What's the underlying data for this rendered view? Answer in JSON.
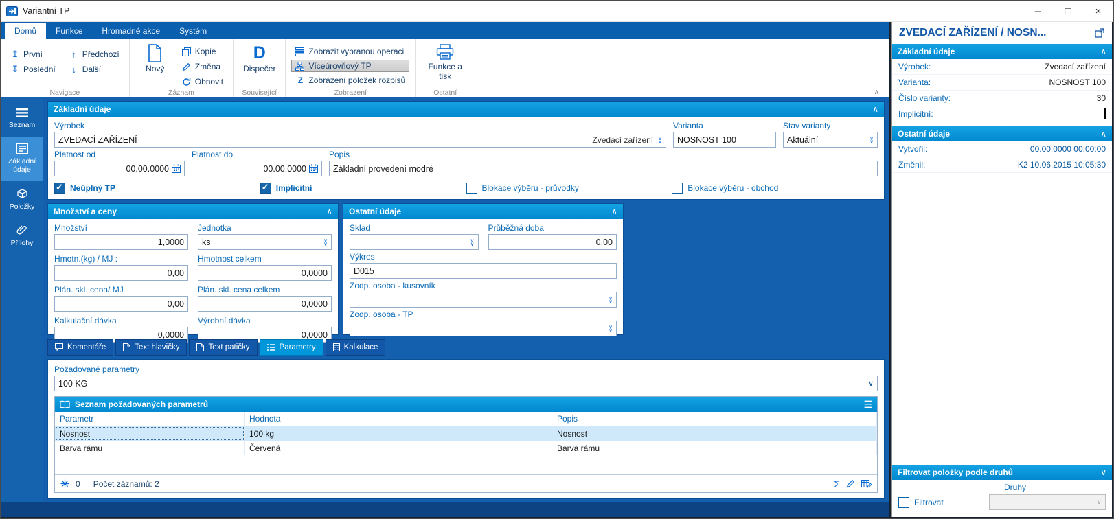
{
  "window": {
    "title": "Variantní TP"
  },
  "icons": {
    "minimize": "–",
    "maximize": "□",
    "close": "×",
    "first": "↥",
    "last": "↧",
    "previous": "↑",
    "next": "↓",
    "chevron_up": "∧",
    "chevron_down": "∨",
    "hamburger": "☰",
    "sigma": "Σ",
    "dispatcher_letter": "D",
    "z_letter": "Z"
  },
  "ribbon": {
    "tabs": [
      {
        "label": "Domů"
      },
      {
        "label": "Funkce"
      },
      {
        "label": "Hromadné akce"
      },
      {
        "label": "Systém"
      }
    ],
    "nav": {
      "first": "První",
      "last": "Poslední",
      "previous": "Předchozí",
      "next": "Další",
      "group_label": "Navigace"
    },
    "record": {
      "new": "Nový",
      "copy": "Kopie",
      "change": "Změna",
      "refresh": "Obnovit",
      "group_label": "Záznam"
    },
    "related": {
      "dispatcher": "Dispečer",
      "group_label": "Související"
    },
    "view": {
      "show_selected": "Zobrazit vybranou operaci",
      "multilevel": "Víceúrovňový TP",
      "show_items": "Zobrazení položek rozpisů",
      "group_label": "Zobrazení"
    },
    "other": {
      "functions_print": "Funkce a tisk",
      "group_label": "Ostatní"
    }
  },
  "sidebar": {
    "items": [
      {
        "label": "Seznam"
      },
      {
        "label": "Základní údaje"
      },
      {
        "label": "Položky"
      },
      {
        "label": "Přílohy"
      }
    ]
  },
  "main": {
    "basic": {
      "title": "Základní údaje",
      "product_label": "Výrobek",
      "product_value": "ZVEDACÍ ZAŘÍZENÍ",
      "product_ref": "Zvedací zařízení",
      "variant_label": "Varianta",
      "variant_value": "NOSNOST 100",
      "state_label": "Stav varianty",
      "state_value": "Aktuální",
      "valid_from_label": "Platnost od",
      "valid_from_value": "00.00.0000",
      "valid_to_label": "Platnost do",
      "valid_to_value": "00.00.0000",
      "desc_label": "Popis",
      "desc_value": "Základní provedení modré",
      "cb_incomplete_label": "Neúplný TP",
      "cb_incomplete_checked": true,
      "cb_implicit_label": "Implicitní",
      "cb_implicit_checked": true,
      "cb_block_pruvodky_label": "Blokace výběru - průvodky",
      "cb_block_pruvodky_checked": false,
      "cb_block_obchod_label": "Blokace výběru - obchod",
      "cb_block_obchod_checked": false
    },
    "qty": {
      "title": "Množství a ceny",
      "qty_label": "Množství",
      "qty_value": "1,0000",
      "unit_label": "Jednotka",
      "unit_value": "ks",
      "weight_label": "Hmotn.(kg) / MJ :",
      "weight_value": "0,00",
      "weight_total_label": "Hmotnost celkem",
      "weight_total_value": "0,0000",
      "price_label": "Plán. skl. cena/ MJ",
      "price_value": "0,00",
      "price_total_label": "Plán. skl. cena celkem",
      "price_total_value": "0,0000",
      "calc_batch_label": "Kalkulační dávka",
      "calc_batch_value": "0,0000",
      "prod_batch_label": "Výrobní dávka",
      "prod_batch_value": "0,0000"
    },
    "other": {
      "title": "Ostatní údaje",
      "warehouse_label": "Sklad",
      "warehouse_value": "",
      "leadtime_label": "Průběžná doba",
      "leadtime_value": "0,00",
      "drawing_label": "Výkres",
      "drawing_value": "D015",
      "resp_bom_label": "Zodp. osoba - kusovník",
      "resp_bom_value": "",
      "resp_tp_label": "Zodp. osoba - TP",
      "resp_tp_value": ""
    },
    "tabs": [
      {
        "label": "Komentáře"
      },
      {
        "label": "Text hlavičky"
      },
      {
        "label": "Text patičky"
      },
      {
        "label": "Parametry"
      },
      {
        "label": "Kalkulace"
      }
    ],
    "params": {
      "required_label": "Požadované parametry",
      "required_value": "100 KG",
      "table_title": "Seznam požadovaných parametrů",
      "columns": [
        "Parametr",
        "Hodnota",
        "Popis"
      ],
      "rows": [
        {
          "parametr": "Nosnost",
          "hodnota": "100 kg",
          "popis": "Nosnost"
        },
        {
          "parametr": "Barva rámu",
          "hodnota": "Červená",
          "popis": "Barva rámu"
        }
      ],
      "footer_number": "0",
      "footer_count_label": "Počet záznamů: 2"
    }
  },
  "preview": {
    "title": "ZVEDACÍ ZAŘÍZENÍ / NOSN...",
    "basic": {
      "title": "Základní údaje",
      "rows": [
        {
          "label": "Výrobek:",
          "value": "Zvedací zařízení"
        },
        {
          "label": "Varianta:",
          "value": "NOSNOST 100"
        },
        {
          "label": "Číslo varianty:",
          "value": "30"
        },
        {
          "label": "Implicitní:",
          "value": ""
        }
      ],
      "implicit_checked": true
    },
    "other": {
      "title": "Ostatní údaje",
      "rows": [
        {
          "label": "Vytvořil:",
          "value": "00.00.0000 00:00:00"
        },
        {
          "label": "Změnil:",
          "value": "K2 10.06.2015 10:05:30"
        }
      ]
    },
    "filter": {
      "title": "Filtrovat položky podle druhů",
      "druhy_label": "Druhy",
      "filtrovat_label": "Filtrovat",
      "filtrovat_checked": false
    }
  },
  "colors": {
    "accent_blue": "#0a64a5",
    "ribbon_strip_blue": "#0a5fae",
    "panel_header_blue": "#0096da",
    "sidebar_blue": "#1563ae",
    "sidebar_selected_blue": "#3a8fd6",
    "content_frame_blue": "#1460ae",
    "selected_row_blue": "#cfe9fb",
    "bottom_strip_blue": "#0d4283"
  }
}
